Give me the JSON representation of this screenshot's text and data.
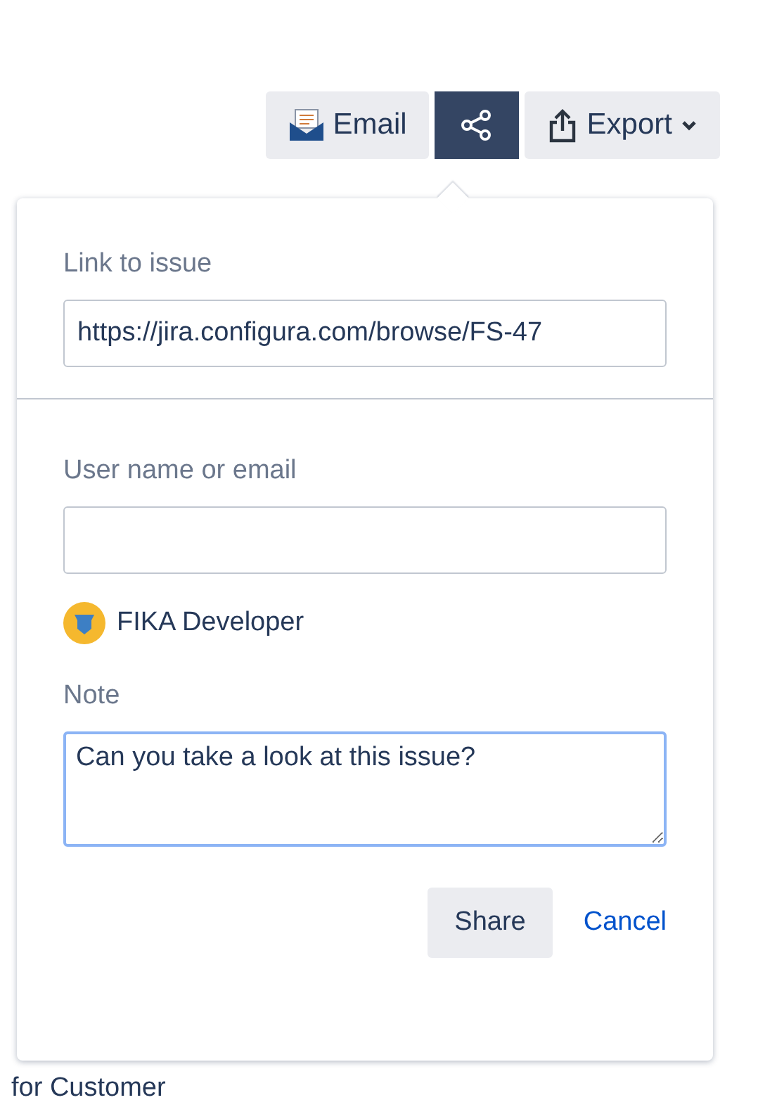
{
  "toolbar": [
    {
      "kind": "email",
      "label": "Email",
      "selected": false
    },
    {
      "kind": "share",
      "selected": true
    },
    {
      "kind": "export",
      "label": "Export",
      "selected": false
    }
  ],
  "share_dialog": {
    "link_label": "Link to issue",
    "link_value": "https://jira.configura.com/browse/FS-47",
    "user_label": "User name or email",
    "recipients": [
      {
        "name": "FIKA Developer"
      }
    ],
    "note_label": "Note",
    "note_value": "Can you take a look at this issue?",
    "share_button": "Share",
    "cancel_link": "Cancel"
  },
  "background_text": "for Customer"
}
